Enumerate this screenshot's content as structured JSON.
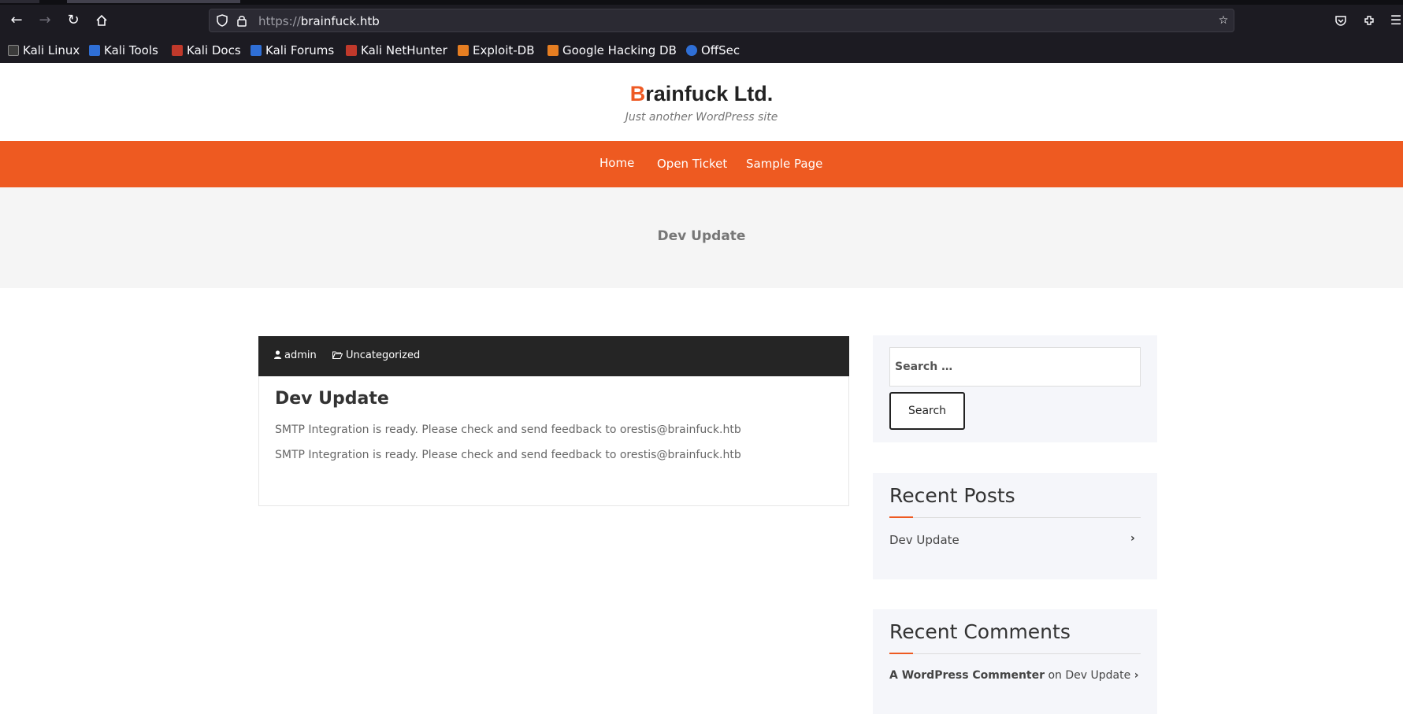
{
  "browser": {
    "url_scheme": "https://",
    "url_host": "brainfuck.htb",
    "bookmarks": [
      {
        "label": "Kali Linux",
        "color": "#3b3b3b"
      },
      {
        "label": "Kali Tools",
        "color": "#2f6fd6"
      },
      {
        "label": "Kali Docs",
        "color": "#c0392b"
      },
      {
        "label": "Kali Forums",
        "color": "#2f6fd6"
      },
      {
        "label": "Kali NetHunter",
        "color": "#c0392b"
      },
      {
        "label": "Exploit-DB",
        "color": "#e67e22"
      },
      {
        "label": "Google Hacking DB",
        "color": "#e67e22"
      },
      {
        "label": "OffSec",
        "color": "#2f6fd6"
      }
    ]
  },
  "site": {
    "title_first": "B",
    "title_rest": "rainfuck Ltd.",
    "description": "Just another WordPress site",
    "accent_color": "#ee5a21"
  },
  "nav": {
    "items": [
      "Home",
      "Open Ticket",
      "Sample Page"
    ]
  },
  "page_title": "Dev Update",
  "post": {
    "author": "admin",
    "category": "Uncategorized",
    "title": "Dev Update",
    "paragraphs": [
      "SMTP Integration is ready. Please check and send feedback to orestis@brainfuck.htb",
      "SMTP Integration is ready. Please check and send feedback to orestis@brainfuck.htb"
    ]
  },
  "sidebar": {
    "search_placeholder": "Search …",
    "search_button": "Search",
    "recent_posts": {
      "title": "Recent Posts",
      "items": [
        "Dev Update"
      ]
    },
    "recent_comments": {
      "title": "Recent Comments",
      "author": "A WordPress Commenter",
      "on_text": "on",
      "post": "Dev Update"
    }
  }
}
